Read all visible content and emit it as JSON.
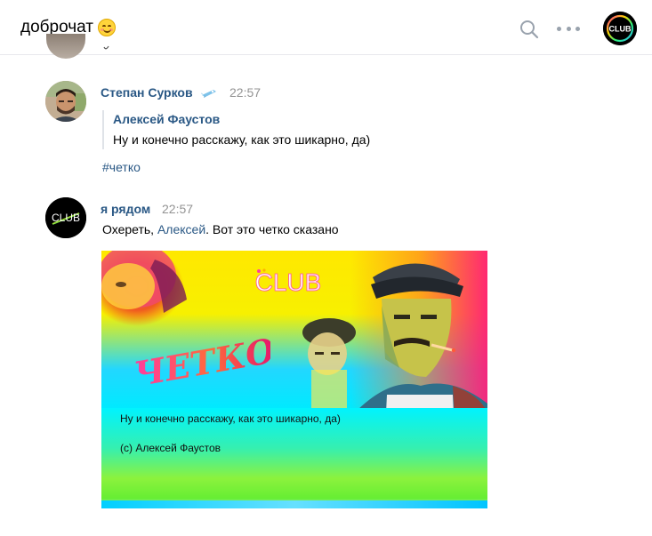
{
  "header": {
    "title": "доброчат",
    "title_emoji": "smiling-face-icon",
    "search_icon": "search-icon",
    "more_icon": "more-horizontal-icon",
    "avatar_text": "CLUB"
  },
  "messages": [
    {
      "author": "Степан Сурков",
      "author_badge": "spaceship-icon",
      "time": "22:57",
      "reply": {
        "author": "Алексей Фаустов",
        "text": "Ну и конечно расскажу, как это шикарно, да)"
      },
      "hashtag": "#четко"
    },
    {
      "author": "я рядом",
      "avatar_text": "CLUB",
      "time": "22:57",
      "text_before": "Охереть, ",
      "mention": "Алексей",
      "text_after": ". Вот это четко сказано",
      "attachment": {
        "logo": "CLUB",
        "stylized_word": "ЧЕТКО!",
        "caption": "Ну и конечно расскажу, как это шикарно, да)",
        "credit": "(с) Алексей Фаустов"
      }
    }
  ],
  "colors": {
    "link": "#2a5885",
    "time": "#939393",
    "icon_gray": "#99a2ad",
    "divider": "#e7e8ec"
  }
}
